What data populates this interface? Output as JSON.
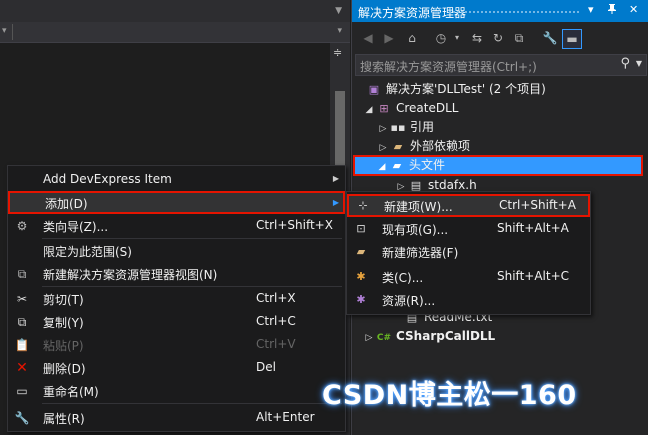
{
  "solution_explorer": {
    "title": "解决方案资源管理器",
    "title_controls": [
      "▾",
      "📌",
      "✕"
    ],
    "search_placeholder": "搜索解决方案资源管理器(Ctrl+;)",
    "tree": [
      {
        "label": "解决方案'DLLTest' (2 个项目)",
        "icon": "solution-icon"
      },
      {
        "label": "CreateDLL",
        "icon": "cpp-project-icon"
      },
      {
        "label": "引用",
        "icon": "references-icon"
      },
      {
        "label": "外部依赖项",
        "icon": "folder-icon"
      },
      {
        "label": "头文件",
        "icon": "filter-folder-icon"
      },
      {
        "label": "stdafx.h",
        "icon": "header-file-icon"
      },
      {
        "label": "ReadMe.txt",
        "icon": "text-file-icon"
      },
      {
        "label": "CSharpCallDLL",
        "icon": "csharp-project-icon"
      }
    ]
  },
  "context_menu": {
    "items": [
      {
        "label": "Add DevExpress Item",
        "shortcut": "",
        "icon": "",
        "submenu": true
      },
      {
        "label": "添加(D)",
        "shortcut": "",
        "icon": "",
        "submenu": true,
        "highlighted": true
      },
      {
        "label": "类向导(Z)...",
        "shortcut": "Ctrl+Shift+X",
        "icon": "class-wizard-icon"
      },
      {
        "label": "限定为此范围(S)",
        "shortcut": "",
        "icon": ""
      },
      {
        "label": "新建解决方案资源管理器视图(N)",
        "shortcut": "",
        "icon": "new-view-icon"
      },
      {
        "label": "剪切(T)",
        "shortcut": "Ctrl+X",
        "icon": "cut-icon"
      },
      {
        "label": "复制(Y)",
        "shortcut": "Ctrl+C",
        "icon": "copy-icon"
      },
      {
        "label": "粘贴(P)",
        "shortcut": "Ctrl+V",
        "icon": "paste-icon",
        "disabled": true
      },
      {
        "label": "删除(D)",
        "shortcut": "Del",
        "icon": "delete-icon"
      },
      {
        "label": "重命名(M)",
        "shortcut": "",
        "icon": "rename-icon"
      },
      {
        "label": "属性(R)",
        "shortcut": "Alt+Enter",
        "icon": "properties-icon"
      }
    ]
  },
  "add_submenu": {
    "items": [
      {
        "label": "新建项(W)...",
        "shortcut": "Ctrl+Shift+A",
        "icon": "new-item-icon",
        "highlighted": true
      },
      {
        "label": "现有项(G)...",
        "shortcut": "Shift+Alt+A",
        "icon": "existing-item-icon"
      },
      {
        "label": "新建筛选器(F)",
        "shortcut": "",
        "icon": "new-filter-icon"
      },
      {
        "label": "类(C)...",
        "shortcut": "Shift+Alt+C",
        "icon": "class-icon"
      },
      {
        "label": "资源(R)...",
        "shortcut": "",
        "icon": "resource-icon"
      }
    ]
  },
  "watermark": "CSDN博主松一160",
  "colors": {
    "accent": "#007acc",
    "selection": "#3399ff",
    "highlight_border": "#e51400",
    "menu_bg": "#1b1b1c",
    "panel_bg": "#252526"
  }
}
